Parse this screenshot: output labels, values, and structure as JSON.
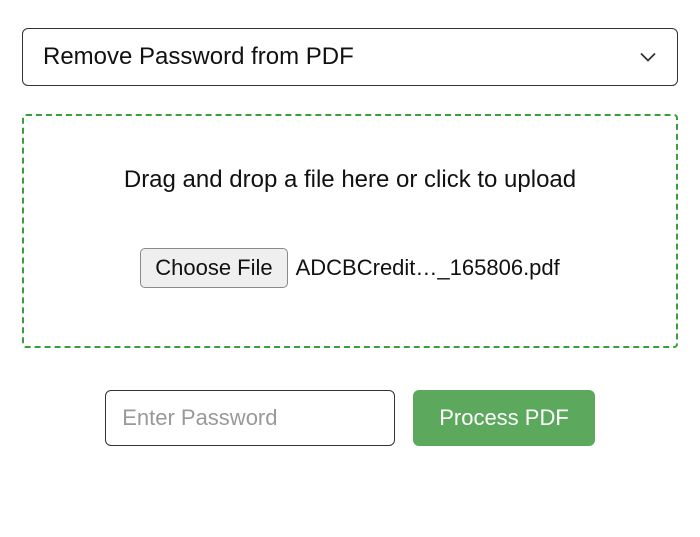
{
  "operation_select": {
    "selected": "Remove Password from PDF"
  },
  "dropzone": {
    "instruction": "Drag and drop a file here or click to upload",
    "choose_file_label": "Choose File",
    "selected_file": "ADCBCredit…_165806.pdf"
  },
  "password": {
    "placeholder": "Enter Password",
    "value": ""
  },
  "process_button_label": "Process PDF"
}
